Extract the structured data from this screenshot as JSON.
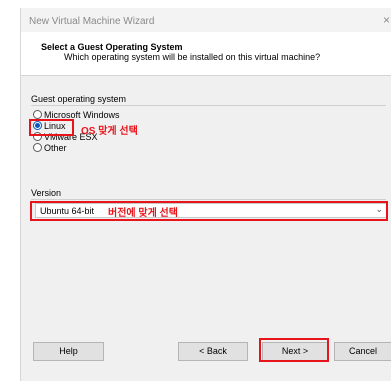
{
  "window": {
    "title": "New Virtual Machine Wizard",
    "close_glyph": "×"
  },
  "header": {
    "title": "Select a Guest Operating System",
    "subtitle": "Which operating system will be installed on this virtual machine?"
  },
  "guest_os": {
    "group_label": "Guest operating system",
    "options": [
      {
        "label": "Microsoft Windows",
        "checked": false
      },
      {
        "label": "Linux",
        "checked": true
      },
      {
        "label": "VMware ESX",
        "checked": false
      },
      {
        "label": "Other",
        "checked": false
      }
    ],
    "annotation": "OS 맞게 선택"
  },
  "version": {
    "label": "Version",
    "selected": "Ubuntu 64-bit",
    "annotation": "버전에 맞게 선택",
    "chevron": "⌄"
  },
  "buttons": {
    "help": "Help",
    "back": "< Back",
    "next": "Next >",
    "cancel": "Cancel"
  },
  "colors": {
    "highlight": "#e8141b",
    "radio_accent": "#0a56bd"
  }
}
